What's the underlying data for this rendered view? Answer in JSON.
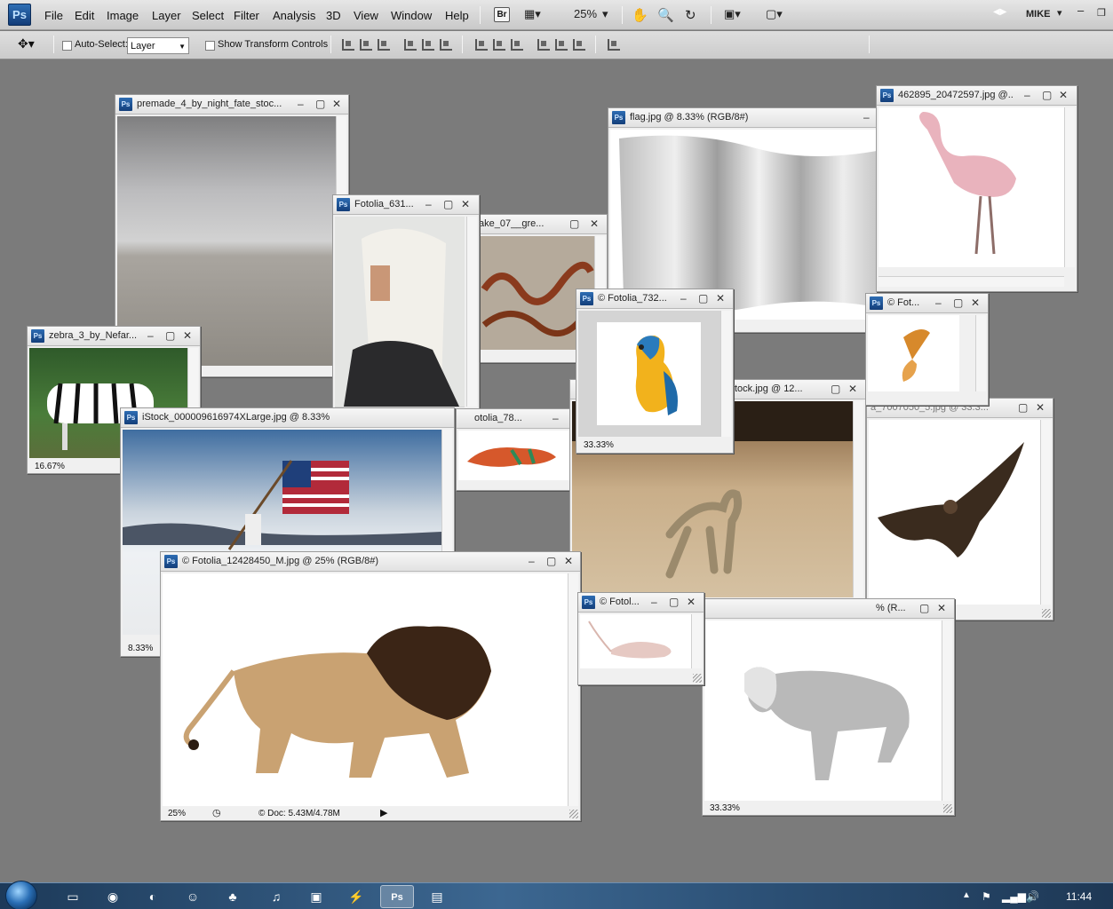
{
  "app": {
    "logo": "Ps",
    "menus": [
      "File",
      "Edit",
      "Image",
      "Layer",
      "Select",
      "Filter",
      "Analysis",
      "3D",
      "View",
      "Window",
      "Help"
    ],
    "bridge": "Br",
    "zoom": "25%",
    "workspace": "MIKE"
  },
  "options": {
    "auto_select_label": "Auto-Select:",
    "auto_select_value": "Layer",
    "transform_label": "Show Transform Controls"
  },
  "windows": {
    "premade": {
      "title": "premade_4_by_night_fate_stoc..."
    },
    "fotolia631": {
      "title": "Fotolia_631..."
    },
    "snake": {
      "title": "ake_07__gre..."
    },
    "flag": {
      "title": "flag.jpg @ 8.33% (RGB/8#)"
    },
    "flamingo": {
      "title": "462895_20472597.jpg @..."
    },
    "zebra": {
      "title": "zebra_3_by_Nefar...",
      "zoom": "16.67%"
    },
    "istock": {
      "title": "iStock_000009616974XLarge.jpg @ 8.33%",
      "zoom": "8.33%"
    },
    "chameleon": {
      "title": "otolia_78..."
    },
    "parrot": {
      "title": "© Fotolia_732...",
      "zoom": "33.33%"
    },
    "butterfly": {
      "title": "© Fot..."
    },
    "monkey": {
      "title": "tock.jpg @ 12..."
    },
    "eagle": {
      "title": "a_7007050_5.jpg @ 33.3..."
    },
    "lion": {
      "title": "© Fotolia_12428450_M.jpg @ 25% (RGB/8#)",
      "zoom": "25%",
      "doc": "© Doc: 5.43M/4.78M"
    },
    "mouse": {
      "title": "© Fotol..."
    },
    "wolf": {
      "title": "% (R...",
      "zoom": "33.33%"
    }
  },
  "taskbar": {
    "time": "11:44",
    "active_app": "Ps"
  }
}
